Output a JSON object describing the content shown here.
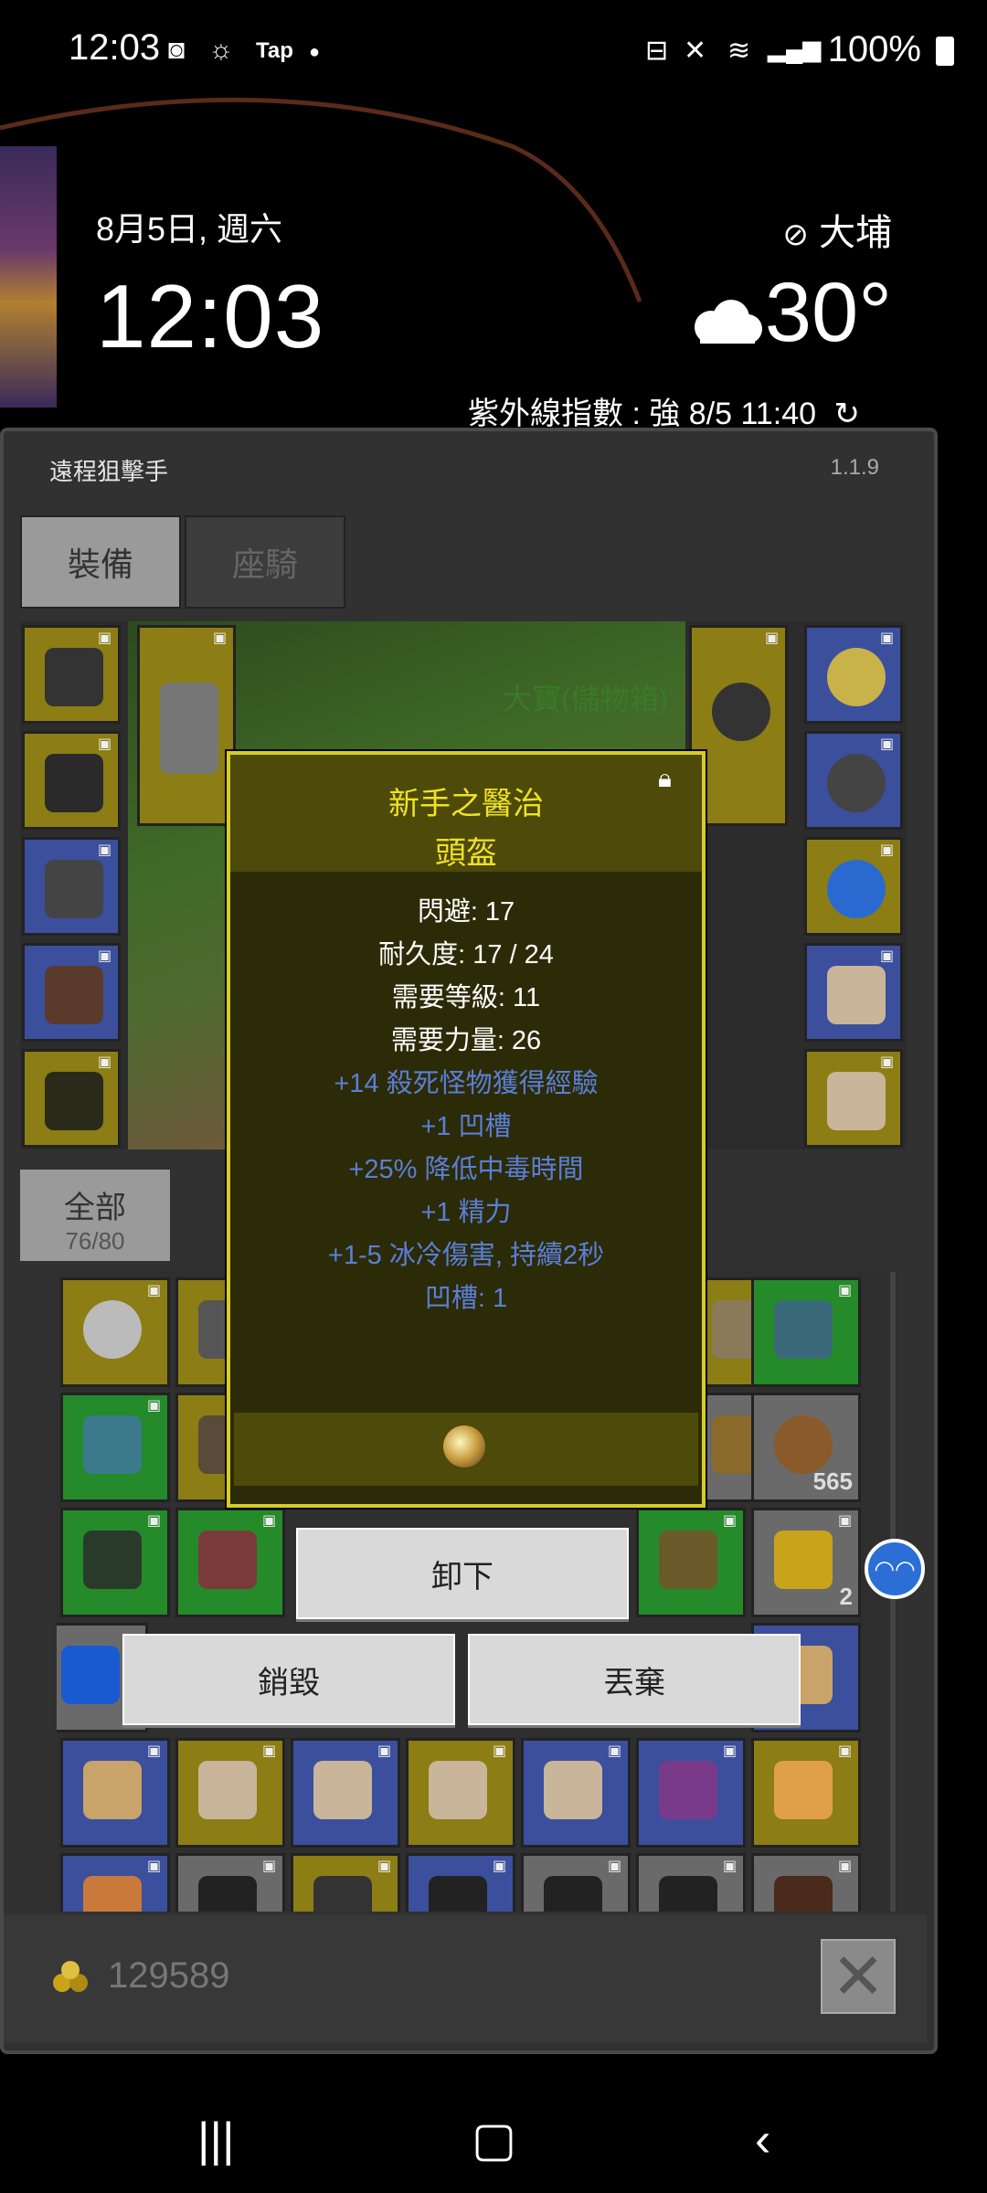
{
  "status_bar": {
    "time": "12:03",
    "tap_label": "Tap",
    "battery": "100%"
  },
  "home_widget": {
    "date": "8月5日, 週六",
    "clock": "12:03",
    "location": "大埔",
    "temperature": "30°",
    "uv_update": "紫外線指數 : 強    8/5 11:40"
  },
  "game": {
    "title": "遠程狙擊手",
    "version": "1.1.9",
    "tabs": [
      {
        "label": "裝備",
        "active": true
      },
      {
        "label": "座騎",
        "active": false
      }
    ],
    "scene_label": "大寶(儲物箱)",
    "filter": {
      "label": "全部",
      "count": "76/80"
    },
    "inventory_counts": [
      "2",
      "565",
      "2"
    ],
    "gold": "129589"
  },
  "tooltip": {
    "name": "新手之醫治",
    "type": "頭盔",
    "stats": [
      "閃避: 17",
      "耐久度: 17 / 24",
      "需要等級: 11",
      "需要力量: 26"
    ],
    "bonuses": [
      "+14 殺死怪物獲得經驗",
      "+1 凹槽",
      "+25% 降低中毒時間",
      "+1 精力",
      "+1-5 冰冷傷害, 持續2秒",
      "凹槽: 1"
    ]
  },
  "actions": {
    "unequip": "卸下",
    "destroy": "銷毀",
    "drop": "丟棄"
  },
  "colors": {
    "tooltip_title": "#f0e224",
    "bonus_text": "#5a7fd8",
    "rarity_yellow": "#8c7d14",
    "rarity_blue": "#3b4f9c",
    "rarity_green": "#258a2a"
  }
}
